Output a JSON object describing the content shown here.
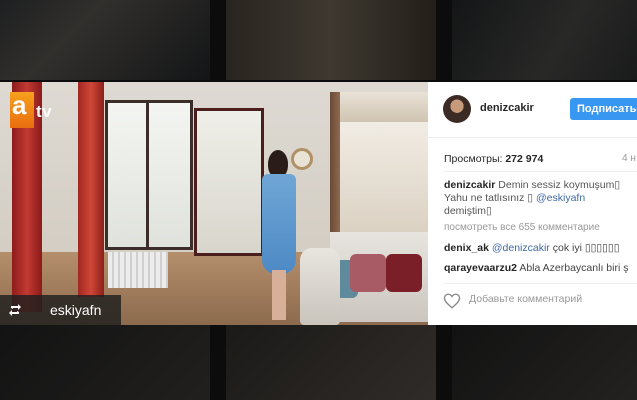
{
  "post": {
    "username": "denizcakir",
    "follow_label": "Подписаться",
    "views_label": "Просмотры:",
    "views_count": "272 974",
    "time_label": "4 н",
    "caption_text": "Demin sessiz koymuşum▯ Yahu ne tatlısınız ▯",
    "caption_mention": "@eskiyafn",
    "caption_end": "demiştim▯",
    "view_all_comments": "посмотреть все 655 комментарие",
    "comments": [
      {
        "user": "denix_ak",
        "mention": "@denizcakir",
        "text": "çok iyi ▯▯▯▯▯▯"
      },
      {
        "user": "qarayevaarzu2",
        "mention": "",
        "text": "Abla Azerbaycanlı biri ş"
      }
    ],
    "add_comment_placeholder": "Добавьте комментарий"
  },
  "media": {
    "channel_logo_a": "a",
    "channel_logo_tv": "tv",
    "repost_username": "eskiyafn"
  },
  "colors": {
    "follow_button": "#3897f0",
    "mention": "#3d6aa2",
    "atv_orange": "#f7a11e"
  },
  "icons": {
    "repost": "repost-icon",
    "like": "heart-icon"
  }
}
